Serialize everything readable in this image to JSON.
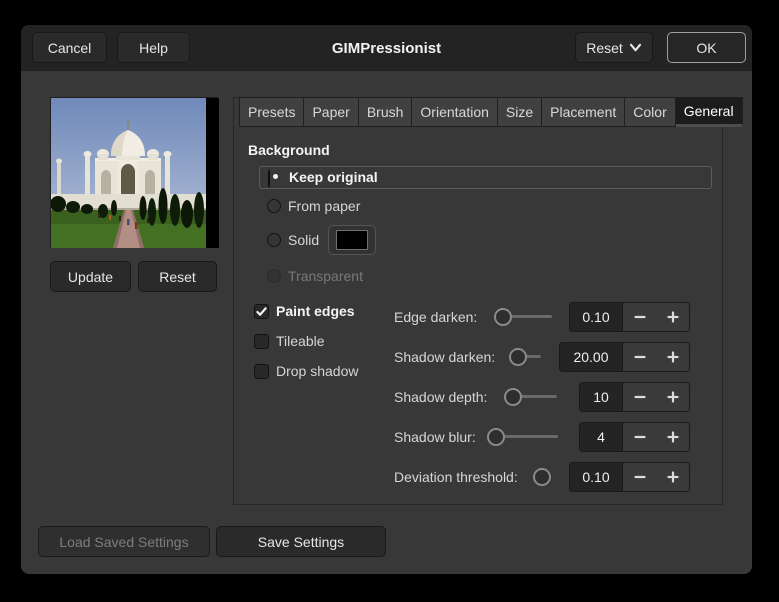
{
  "window": {
    "title": "GIMPressionist"
  },
  "header": {
    "cancel_label": "Cancel",
    "help_label": "Help",
    "reset_label": "Reset",
    "ok_label": "OK"
  },
  "preview": {
    "description": "Taj Mahal photo preview",
    "update_label": "Update",
    "reset_label": "Reset"
  },
  "tabs": [
    {
      "label": "Presets"
    },
    {
      "label": "Paper"
    },
    {
      "label": "Brush"
    },
    {
      "label": "Orientation"
    },
    {
      "label": "Size"
    },
    {
      "label": "Placement"
    },
    {
      "label": "Color"
    },
    {
      "label": "General",
      "active": true
    }
  ],
  "general": {
    "section_label": "Background",
    "radios": [
      {
        "label": "Keep original",
        "selected": true
      },
      {
        "label": "From paper",
        "selected": false
      },
      {
        "label": "Solid",
        "selected": false,
        "swatch_color": "#000000"
      },
      {
        "label": "Transparent",
        "selected": false,
        "disabled": true
      }
    ],
    "checkboxes": [
      {
        "label": "Paint edges",
        "checked": true
      },
      {
        "label": "Tileable",
        "checked": false
      },
      {
        "label": "Drop shadow",
        "checked": false
      }
    ],
    "sliders": [
      {
        "label": "Edge darken:",
        "value": "0.10"
      },
      {
        "label": "Shadow darken:",
        "value": "20.00"
      },
      {
        "label": "Shadow depth:",
        "value": "10"
      },
      {
        "label": "Shadow blur:",
        "value": "4"
      },
      {
        "label": "Deviation threshold:",
        "value": "0.10"
      }
    ]
  },
  "footer": {
    "load_label": "Load Saved Settings",
    "save_label": "Save Settings",
    "load_disabled": true
  },
  "colors": {
    "dialog_bg": "#383838",
    "header_bg": "#232323",
    "active_tab_bg": "#1c1c1c",
    "solid_swatch": "#000000"
  }
}
